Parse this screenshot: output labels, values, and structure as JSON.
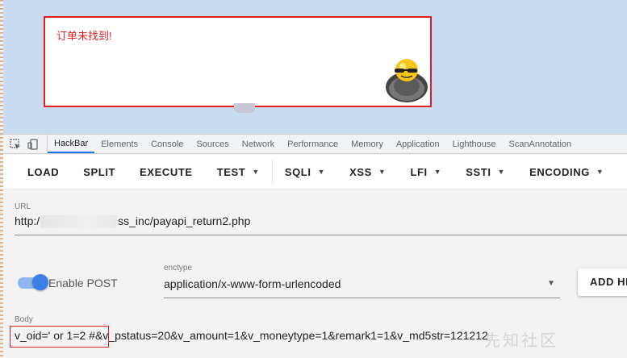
{
  "alert": {
    "message": "订单未找到!"
  },
  "devtools": {
    "tabs": [
      "HackBar",
      "Elements",
      "Console",
      "Sources",
      "Network",
      "Performance",
      "Memory",
      "Application",
      "Lighthouse",
      "ScanAnnotation"
    ],
    "active_tab": "HackBar"
  },
  "toolbar": {
    "load": "LOAD",
    "split": "SPLIT",
    "execute": "EXECUTE",
    "test": "TEST",
    "sqli": "SQLI",
    "xss": "XSS",
    "lfi": "LFI",
    "ssti": "SSTI",
    "encoding": "ENCODING"
  },
  "url": {
    "label": "URL",
    "prefix": "http:/",
    "suffix": "ss_inc/payapi_return2.php"
  },
  "post": {
    "label": "Enable POST",
    "enabled": true
  },
  "enctype": {
    "label": "enctype",
    "value": "application/x-www-form-urlencoded"
  },
  "add_header_button": "ADD HEADER",
  "body": {
    "label": "Body",
    "value": "v_oid=' or 1=2 #&v_pstatus=20&v_amount=1&v_moneytype=1&remark1=1&v_md5str=121212"
  },
  "watermark": "先知社区",
  "colors": {
    "accent": "#1a73e8",
    "alert_red": "#e02020",
    "page_bg": "#c9dcf2"
  }
}
